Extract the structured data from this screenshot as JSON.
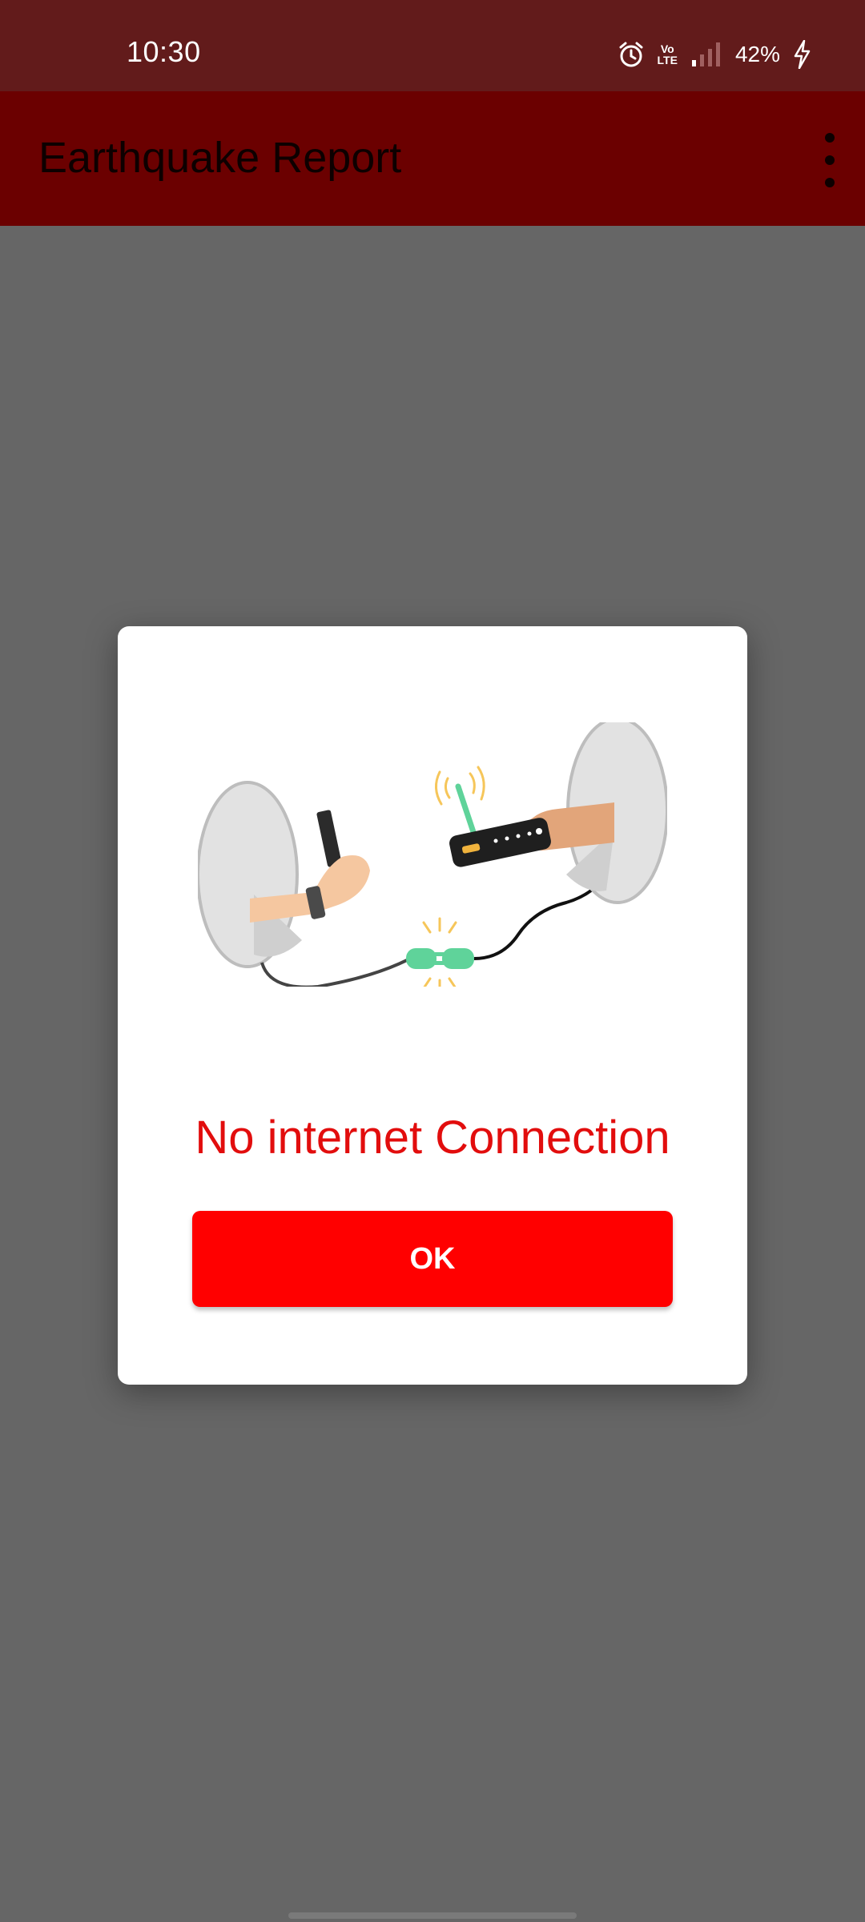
{
  "status_bar": {
    "time": "10:30",
    "network_label": "Vo LTE",
    "battery": "42%",
    "icons": [
      "alarm-icon",
      "volte-icon",
      "signal-icon",
      "charging-icon"
    ]
  },
  "app_bar": {
    "title": "Earthquake Report",
    "menu_icon": "overflow-menu-icon"
  },
  "dialog": {
    "illustration": "no-connection-illustration",
    "message": "No internet Connection",
    "ok_label": "OK"
  },
  "colors": {
    "status_bar": "#621b1b",
    "app_bar": "#6b0000",
    "scrim": "#666666",
    "message_text": "#e20d0d",
    "button": "#ff0000"
  }
}
